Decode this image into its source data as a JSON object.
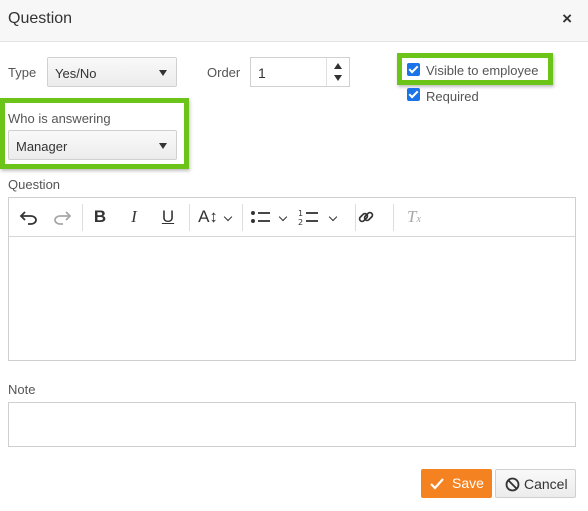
{
  "dialog": {
    "title": "Question",
    "close_glyph": "×",
    "close_icon": "close-icon"
  },
  "type_field": {
    "label": "Type",
    "value": "Yes/No"
  },
  "order_field": {
    "label": "Order",
    "value": "1"
  },
  "visible_checkbox": {
    "label": "Visible to employee",
    "checked": true
  },
  "required_checkbox": {
    "label": "Required",
    "checked": true
  },
  "answering_field": {
    "label": "Who is answering",
    "value": "Manager"
  },
  "question_editor": {
    "label": "Question",
    "toolbar": [
      {
        "name": "undo-icon",
        "glyph": "↶"
      },
      {
        "name": "redo-icon",
        "glyph": "↷",
        "disabled": true
      },
      {
        "name": "bold-icon",
        "glyph": "B"
      },
      {
        "name": "italic-icon",
        "glyph": "I"
      },
      {
        "name": "underline-icon",
        "glyph": "U"
      },
      {
        "name": "font-size-icon",
        "glyph": "A↕"
      },
      {
        "name": "bulleted-list-icon",
        "glyph": "list"
      },
      {
        "name": "numbered-list-icon",
        "glyph": "list"
      },
      {
        "name": "link-icon",
        "glyph": "link"
      },
      {
        "name": "clear-format-icon",
        "glyph": "Tx",
        "disabled": true
      }
    ],
    "content": ""
  },
  "note_field": {
    "label": "Note",
    "value": ""
  },
  "buttons": {
    "save": "Save",
    "cancel": "Cancel"
  },
  "colors": {
    "highlight": "#6cc419",
    "save": "#f58220",
    "checkbox": "#1a73e8"
  }
}
